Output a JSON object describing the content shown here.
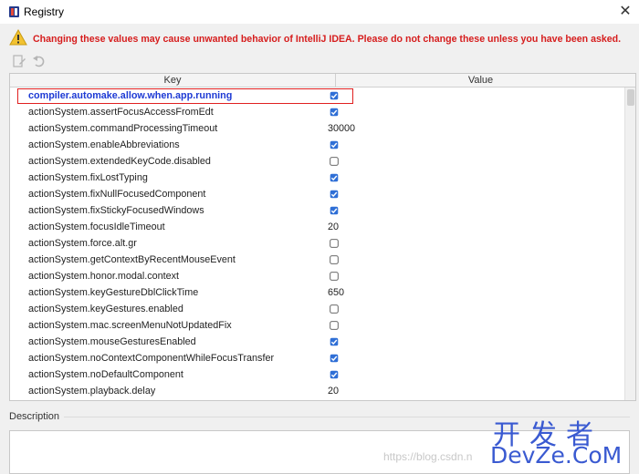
{
  "window": {
    "title": "Registry",
    "close_glyph": "✕",
    "app_icon": "registry-app-icon",
    "close_icon": "close-icon"
  },
  "warning": {
    "icon": "warning-triangle-icon",
    "text": "Changing these values may cause unwanted behavior of IntelliJ IDEA. Please do not change these unless you have been asked."
  },
  "toolbar": {
    "buttons": [
      {
        "name": "edit-icon",
        "enabled": false
      },
      {
        "name": "revert-icon",
        "enabled": false
      }
    ]
  },
  "table": {
    "columns": [
      "Key",
      "Value"
    ],
    "rows": [
      {
        "key": "compiler.automake.allow.when.app.running",
        "type": "checkbox",
        "checked": true,
        "modified": true
      },
      {
        "key": "actionSystem.assertFocusAccessFromEdt",
        "type": "checkbox",
        "checked": true
      },
      {
        "key": "actionSystem.commandProcessingTimeout",
        "type": "text",
        "value": "30000"
      },
      {
        "key": "actionSystem.enableAbbreviations",
        "type": "checkbox",
        "checked": true
      },
      {
        "key": "actionSystem.extendedKeyCode.disabled",
        "type": "checkbox",
        "checked": false
      },
      {
        "key": "actionSystem.fixLostTyping",
        "type": "checkbox",
        "checked": true
      },
      {
        "key": "actionSystem.fixNullFocusedComponent",
        "type": "checkbox",
        "checked": true
      },
      {
        "key": "actionSystem.fixStickyFocusedWindows",
        "type": "checkbox",
        "checked": true
      },
      {
        "key": "actionSystem.focusIdleTimeout",
        "type": "text",
        "value": "20"
      },
      {
        "key": "actionSystem.force.alt.gr",
        "type": "checkbox",
        "checked": false
      },
      {
        "key": "actionSystem.getContextByRecentMouseEvent",
        "type": "checkbox",
        "checked": false
      },
      {
        "key": "actionSystem.honor.modal.context",
        "type": "checkbox",
        "checked": false
      },
      {
        "key": "actionSystem.keyGestureDblClickTime",
        "type": "text",
        "value": "650"
      },
      {
        "key": "actionSystem.keyGestures.enabled",
        "type": "checkbox",
        "checked": false
      },
      {
        "key": "actionSystem.mac.screenMenuNotUpdatedFix",
        "type": "checkbox",
        "checked": false
      },
      {
        "key": "actionSystem.mouseGesturesEnabled",
        "type": "checkbox",
        "checked": true
      },
      {
        "key": "actionSystem.noContextComponentWhileFocusTransfer",
        "type": "checkbox",
        "checked": true
      },
      {
        "key": "actionSystem.noDefaultComponent",
        "type": "checkbox",
        "checked": true
      },
      {
        "key": "actionSystem.playback.delay",
        "type": "text",
        "value": "20"
      }
    ]
  },
  "description": {
    "label": "Description",
    "text": ""
  },
  "watermark": {
    "url": "https://blog.csdn.n",
    "cn": "开发者",
    "en": "DevZe.CoM"
  },
  "colors": {
    "warning_red": "#d61d1d",
    "modified_blue": "#1d3ad4",
    "checkbox_blue": "#2f6fd6",
    "highlight_red": "#e02020"
  }
}
